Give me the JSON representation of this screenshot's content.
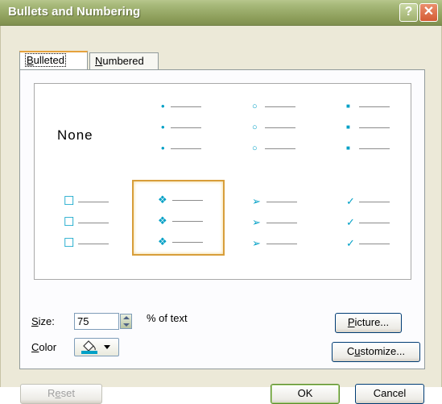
{
  "window": {
    "title": "Bullets and Numbering",
    "help_glyph": "?",
    "close_glyph": "✕"
  },
  "tabs": [
    {
      "label_u": "B",
      "label_rest": "ulleted",
      "active": true
    },
    {
      "label_u": "N",
      "label_rest": "umbered",
      "active": false
    }
  ],
  "bullet_styles": {
    "none_label": "None",
    "selected_index": 5,
    "bullet_color": "#00a0c6",
    "styles": [
      {
        "name": "none"
      },
      {
        "name": "small-dot",
        "symbol": "•"
      },
      {
        "name": "hollow-circle",
        "symbol": "○"
      },
      {
        "name": "filled-square",
        "symbol": "■"
      },
      {
        "name": "hollow-square",
        "symbol": "☐"
      },
      {
        "name": "four-diamond",
        "symbol": "❖"
      },
      {
        "name": "arrowhead",
        "symbol": "➢"
      },
      {
        "name": "checkmark",
        "symbol": "✓"
      }
    ]
  },
  "size": {
    "label_u": "S",
    "label_rest": "ize:",
    "value": "75",
    "suffix": "% of text"
  },
  "color": {
    "label_u": "C",
    "label_rest": "olor",
    "value": "#00a0c6"
  },
  "buttons": {
    "picture": {
      "label_u": "P",
      "label_rest": "icture..."
    },
    "customize": {
      "label_pre": "C",
      "label_u": "u",
      "label_rest": "stomize..."
    },
    "reset": {
      "label_pre": "R",
      "label_u": "e",
      "label_rest": "set"
    },
    "ok": "OK",
    "cancel": "Cancel"
  }
}
